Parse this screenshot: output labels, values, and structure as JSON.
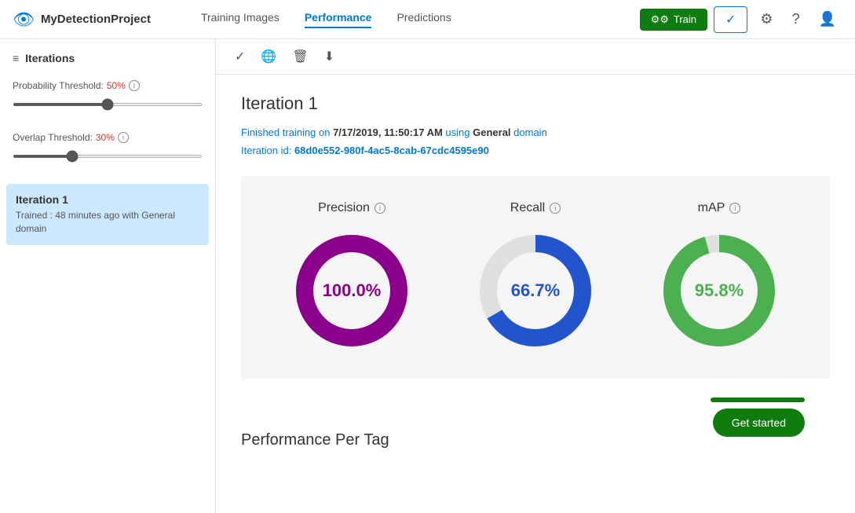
{
  "header": {
    "logo_icon": "👁",
    "project_name": "MyDetectionProject",
    "nav_items": [
      {
        "label": "Training Images",
        "active": false
      },
      {
        "label": "Performance",
        "active": true
      },
      {
        "label": "Predictions",
        "active": false
      }
    ],
    "btn_train_label": "Train",
    "btn_check_label": "✓",
    "settings_icon": "⚙",
    "help_icon": "?",
    "avatar_icon": "👤"
  },
  "sidebar": {
    "header_label": "Iterations",
    "probability_threshold_label": "Probability Threshold:",
    "probability_threshold_value": "50%",
    "overlap_threshold_label": "Overlap Threshold:",
    "overlap_threshold_value": "30%",
    "iteration": {
      "title": "Iteration 1",
      "subtitle": "Trained : 48 minutes ago with General domain"
    }
  },
  "toolbar": {
    "check_icon": "✓",
    "globe_icon": "🌐",
    "trash_icon": "🗑",
    "download_icon": "⬇"
  },
  "content": {
    "iteration_title": "Iteration 1",
    "training_info_1": "Finished training on ",
    "training_date": "7/17/2019, 11:50:17 AM",
    "training_info_2": " using ",
    "training_domain": "General",
    "training_info_3": " domain",
    "iteration_id_label": "Iteration id: ",
    "iteration_id": "68d0e552-980f-4ac5-8cab-67cdc4595e90",
    "metrics": [
      {
        "label": "Precision",
        "value": "100.0%",
        "color": "#8b008b",
        "bg_color": "#e8e8e8",
        "percentage": 100
      },
      {
        "label": "Recall",
        "value": "66.7%",
        "color": "#2255cc",
        "bg_color": "#e8e8e8",
        "percentage": 66.7
      },
      {
        "label": "mAP",
        "value": "95.8%",
        "color": "#4caf50",
        "bg_color": "#e8e8e8",
        "percentage": 95.8
      }
    ],
    "perf_per_tag_title": "Performance Per Tag",
    "get_started_label": "Get started"
  }
}
